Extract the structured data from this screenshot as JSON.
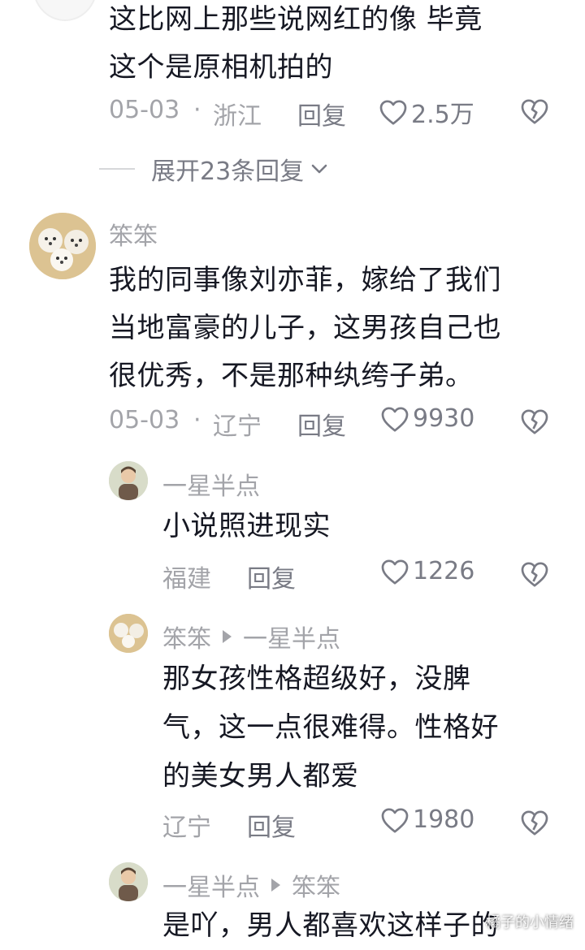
{
  "top_comment": {
    "text_lines": [
      "这比网上那些说网红的像 毕竟",
      "这个是原相机拍的"
    ],
    "date": "05-03",
    "sep": "·",
    "location": "浙江",
    "reply_label": "回复",
    "likes": "2.5万",
    "expand_label": "展开23条回复"
  },
  "comment2": {
    "username": "笨笨",
    "text_lines": [
      "我的同事像刘亦菲，嫁给了我们",
      "当地富豪的儿子，这男孩自己也",
      "很优秀，不是那种纨绔子弟。"
    ],
    "date": "05-03",
    "sep": "·",
    "location": "辽宁",
    "reply_label": "回复",
    "likes": "9930"
  },
  "replies": [
    {
      "username": "一星半点",
      "reply_to": "",
      "text_lines": [
        "小说照进现实"
      ],
      "location": "福建",
      "reply_label": "回复",
      "likes": "1226"
    },
    {
      "username": "笨笨",
      "reply_to": "一星半点",
      "text_lines": [
        "那女孩性格超级好，没脾",
        "气，这一点很难得。性格好",
        "的美女男人都爱"
      ],
      "location": "辽宁",
      "reply_label": "回复",
      "likes": "1980"
    },
    {
      "username": "一星半点",
      "reply_to": "笨笨",
      "text_lines": [
        "是吖，男人都喜欢这样子的"
      ]
    }
  ],
  "watermark": "橘子的小情绪",
  "icons": {
    "like": "heart-outline-icon",
    "dislike": "broken-heart-icon",
    "expand": "chevron-down-icon"
  },
  "colors": {
    "text": "#161823",
    "meta": "#a3a4a9",
    "action": "#797b85"
  }
}
